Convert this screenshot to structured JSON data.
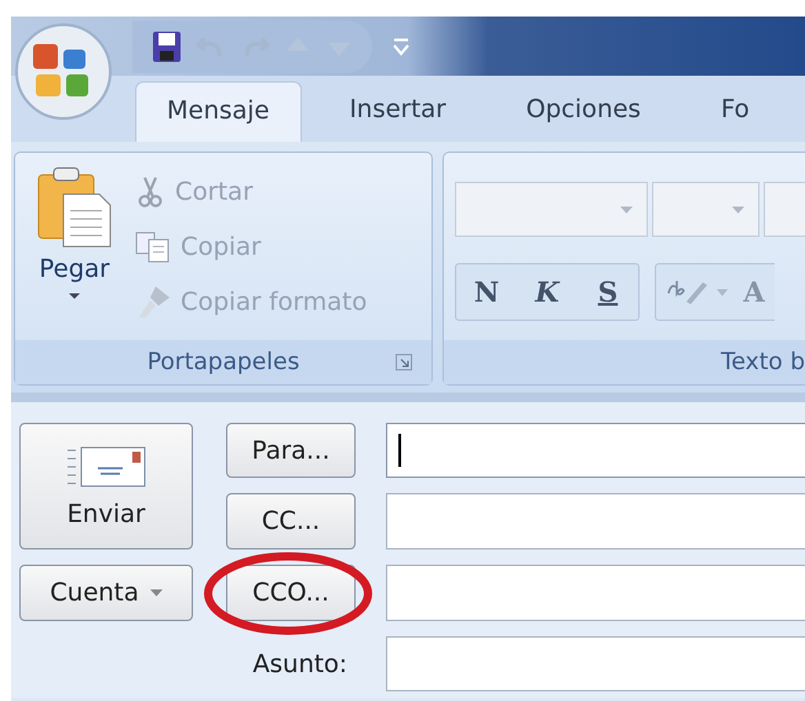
{
  "tabs": [
    {
      "label": "Mensaje",
      "selected": true
    },
    {
      "label": "Insertar",
      "selected": false
    },
    {
      "label": "Opciones",
      "selected": false
    },
    {
      "label": "Fo",
      "selected": false
    }
  ],
  "ribbon": {
    "groups": [
      {
        "kind": "clipboard",
        "label": "Portapapeles",
        "paste": {
          "label": "Pegar",
          "disabled": false
        },
        "items": [
          {
            "kind": "cut",
            "label": "Cortar",
            "disabled": true
          },
          {
            "kind": "copy",
            "label": "Copiar",
            "disabled": true
          },
          {
            "kind": "format",
            "label": "Copiar formato",
            "disabled": true
          }
        ]
      },
      {
        "kind": "text",
        "label": "Texto b",
        "format_buttons": [
          {
            "kind": "bold",
            "label": "N"
          },
          {
            "kind": "italic",
            "label": "K"
          },
          {
            "kind": "underline",
            "label": "S"
          }
        ],
        "color_button": {
          "label": "A"
        }
      }
    ]
  },
  "compose": {
    "send": {
      "label": "Enviar"
    },
    "account": {
      "label": "Cuenta"
    },
    "fields": [
      {
        "kind": "button",
        "label": "Para...",
        "focused": true,
        "highlighted": false
      },
      {
        "kind": "button",
        "label": "CC...",
        "focused": false,
        "highlighted": false
      },
      {
        "kind": "button",
        "label": "CCO...",
        "focused": false,
        "highlighted": true
      },
      {
        "kind": "label",
        "label": "Asunto:",
        "focused": false,
        "highlighted": false
      }
    ]
  }
}
